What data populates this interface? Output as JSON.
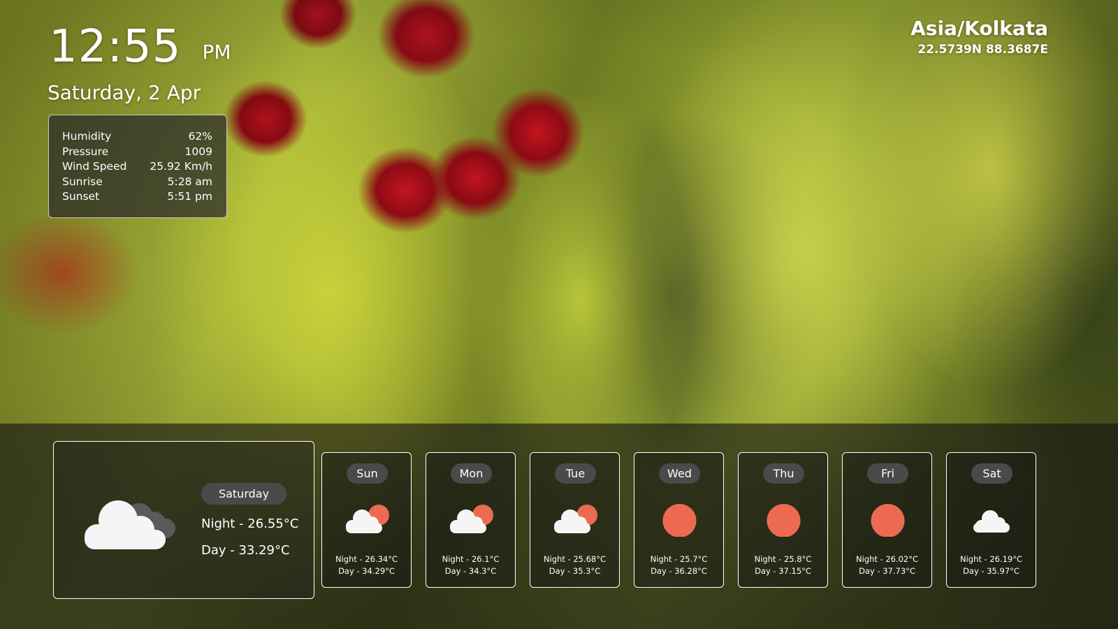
{
  "clock": {
    "time": "12:55",
    "ampm": "PM",
    "date": "Saturday, 2 Apr"
  },
  "stats": [
    {
      "label": "Humidity",
      "value": "62%"
    },
    {
      "label": "Pressure",
      "value": "1009"
    },
    {
      "label": "Wind Speed",
      "value": "25.92 Km/h"
    },
    {
      "label": "Sunrise",
      "value": "5:28 am"
    },
    {
      "label": "Sunset",
      "value": "5:51 pm"
    }
  ],
  "location": {
    "timezone": "Asia/Kolkata",
    "coords": "22.5739N 88.3687E"
  },
  "today": {
    "day": "Saturday",
    "night": "Night - 26.55°C",
    "daytemp": "Day - 33.29°C",
    "icon": "cloudy-icon"
  },
  "forecast": [
    {
      "day": "Sun",
      "night": "Night - 26.34°C",
      "daytemp": "Day - 34.29°C",
      "icon": "partly-cloudy-icon"
    },
    {
      "day": "Mon",
      "night": "Night - 26.1°C",
      "daytemp": "Day - 34.3°C",
      "icon": "partly-cloudy-icon"
    },
    {
      "day": "Tue",
      "night": "Night - 25.68°C",
      "daytemp": "Day - 35.3°C",
      "icon": "partly-cloudy-icon"
    },
    {
      "day": "Wed",
      "night": "Night - 25.7°C",
      "daytemp": "Day - 36.28°C",
      "icon": "sun-icon"
    },
    {
      "day": "Thu",
      "night": "Night - 25.8°C",
      "daytemp": "Day - 37.15°C",
      "icon": "sun-icon"
    },
    {
      "day": "Fri",
      "night": "Night - 26.02°C",
      "daytemp": "Day - 37.73°C",
      "icon": "sun-icon"
    },
    {
      "day": "Sat",
      "night": "Night - 26.19°C",
      "daytemp": "Day - 35.97°C",
      "icon": "cloud-icon"
    }
  ],
  "colors": {
    "sun": "#ec6b50",
    "cloud": "#f5f5f5",
    "dark_cloud": "#5a5a5a",
    "pill": "#4a4a4a"
  }
}
